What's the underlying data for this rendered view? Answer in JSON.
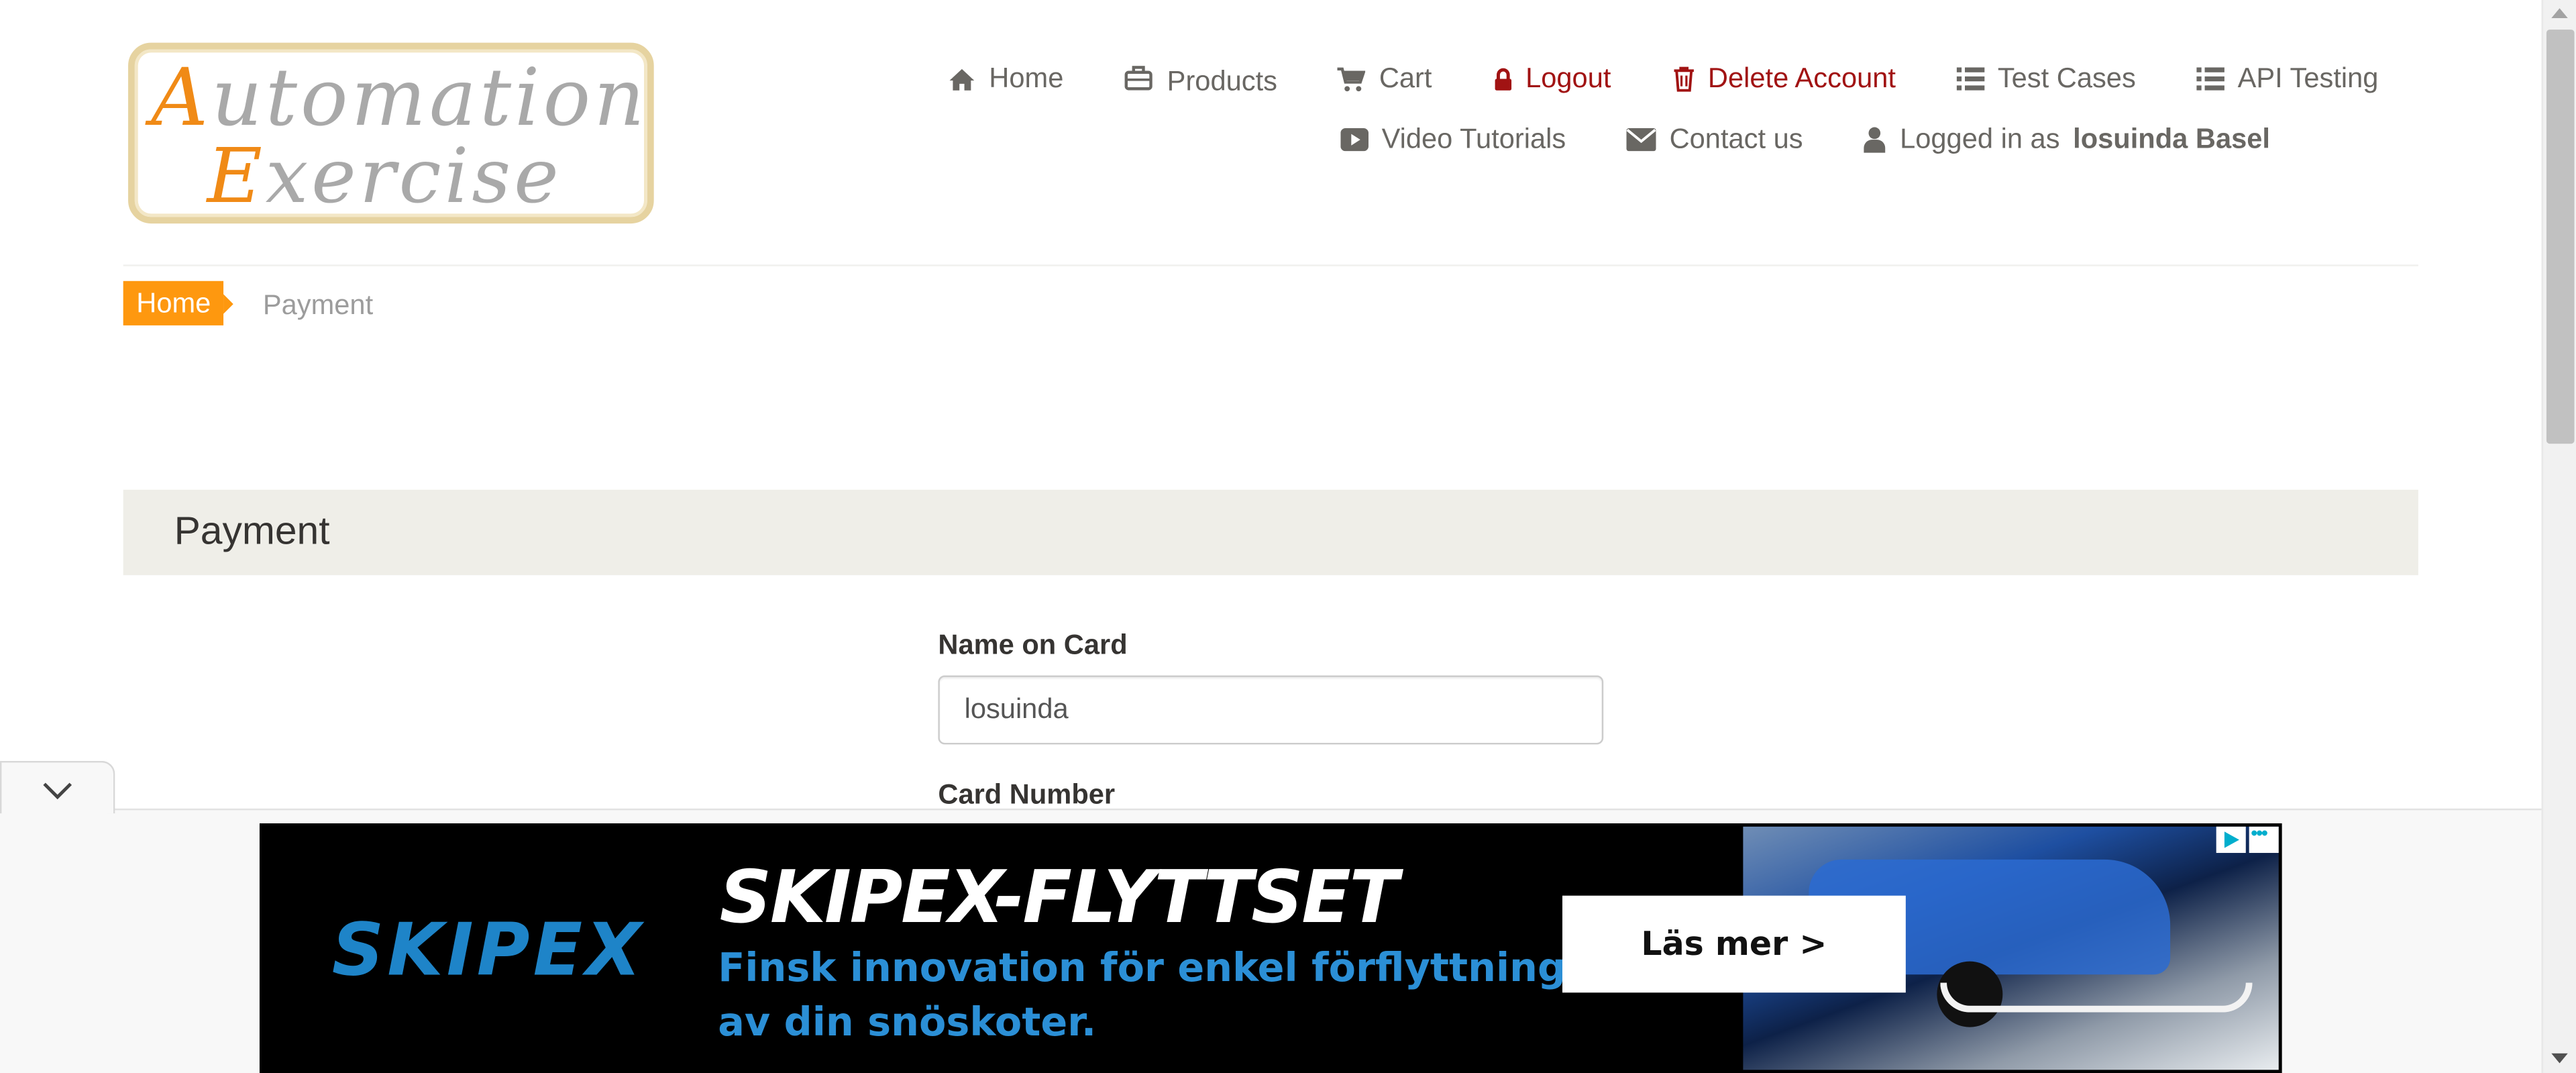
{
  "logo": {
    "line1_cap": "A",
    "line1_rest": "utomation",
    "line2_cap": "E",
    "line2_rest": "xercise"
  },
  "nav": {
    "home": "Home",
    "products": "Products",
    "cart": "Cart",
    "logout": "Logout",
    "delete_account": "Delete Account",
    "test_cases": "Test Cases",
    "api_testing": "API Testing",
    "video_tutorials": "Video Tutorials",
    "contact_us": "Contact us",
    "logged_in_prefix": "Logged in as",
    "logged_in_user": "losuinda Basel"
  },
  "breadcrumb": {
    "home": "Home",
    "current": "Payment"
  },
  "payment": {
    "heading": "Payment",
    "name_label": "Name on Card",
    "name_value": "losuinda",
    "card_label": "Card Number"
  },
  "ad": {
    "brand": "SKIPEX",
    "headline": "SKIPEX-FLYTTSET",
    "sub1": "Finsk innovation för enkel förflyttning",
    "sub2": "av din snöskoter.",
    "cta": "Läs mer >"
  },
  "colors": {
    "accent": "#fe980f",
    "danger": "#a11313",
    "text": "#696763",
    "band": "#efeee8"
  },
  "icons": [
    "home-icon",
    "briefcase-icon",
    "cart-icon",
    "lock-icon",
    "trash-icon",
    "list-icon",
    "youtube-play-icon",
    "envelope-icon",
    "user-icon",
    "chevron-down-icon"
  ]
}
